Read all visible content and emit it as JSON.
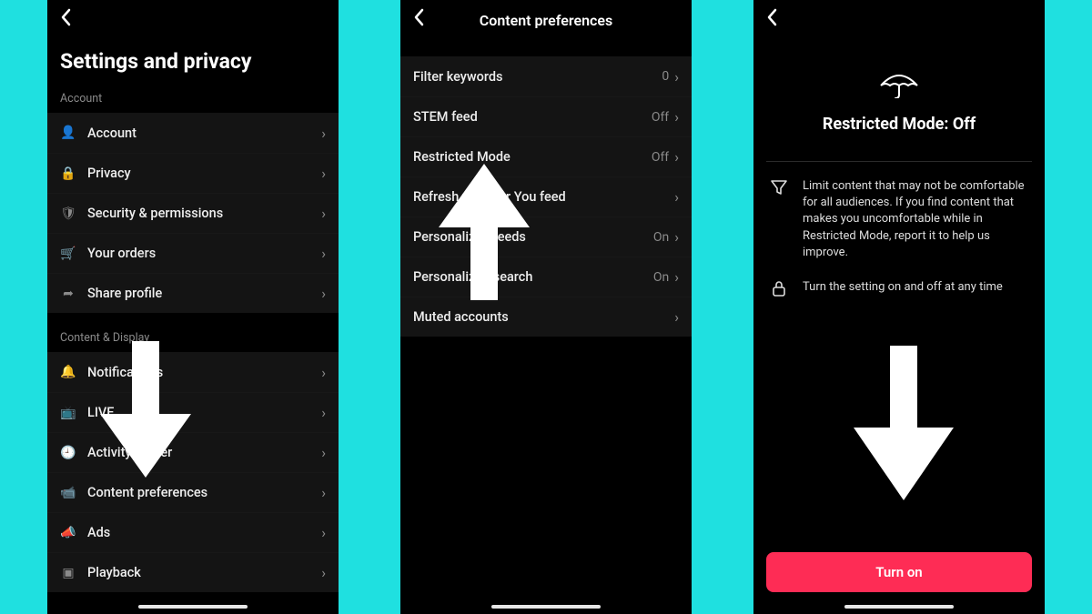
{
  "colors": {
    "accent": "#fe2c55",
    "bg": "#1fe0e0"
  },
  "screen1": {
    "title": "Settings and privacy",
    "sections": [
      {
        "label": "Account",
        "items": [
          {
            "icon": "person-icon",
            "glyph": "👤",
            "label": "Account"
          },
          {
            "icon": "lock-icon",
            "glyph": "🔒",
            "label": "Privacy"
          },
          {
            "icon": "shield-icon",
            "glyph": "🛡",
            "label": "Security & permissions"
          },
          {
            "icon": "cart-icon",
            "glyph": "🛒",
            "label": "Your orders"
          },
          {
            "icon": "share-icon",
            "glyph": "➦",
            "label": "Share profile"
          }
        ]
      },
      {
        "label": "Content & Display",
        "items": [
          {
            "icon": "bell-icon",
            "glyph": "🔔",
            "label": "Notifications"
          },
          {
            "icon": "tv-icon",
            "glyph": "📺",
            "label": "LIVE"
          },
          {
            "icon": "clock-icon",
            "glyph": "🕘",
            "label": "Activity center"
          },
          {
            "icon": "camera-icon",
            "glyph": "📹",
            "label": "Content preferences"
          },
          {
            "icon": "megaphone-icon",
            "glyph": "📣",
            "label": "Ads"
          },
          {
            "icon": "play-icon",
            "glyph": "▣",
            "label": "Playback"
          }
        ]
      }
    ]
  },
  "screen2": {
    "title": "Content preferences",
    "items": [
      {
        "label": "Filter keywords",
        "value": "0"
      },
      {
        "label": "STEM feed",
        "value": "Off"
      },
      {
        "label": "Restricted Mode",
        "value": "Off"
      },
      {
        "label": "Refresh your For You feed",
        "value": ""
      },
      {
        "label": "Personalized feeds",
        "value": "On"
      },
      {
        "label": "Personalized search",
        "value": "On"
      },
      {
        "label": "Muted accounts",
        "value": ""
      }
    ]
  },
  "screen3": {
    "mode_title": "Restricted Mode: Off",
    "info1": "Limit content that may not be comfortable for all audiences. If you find content that makes you uncomfortable while in Restricted Mode, report it to help us improve.",
    "info2": "Turn the setting on and off at any time",
    "cta": "Turn on"
  }
}
